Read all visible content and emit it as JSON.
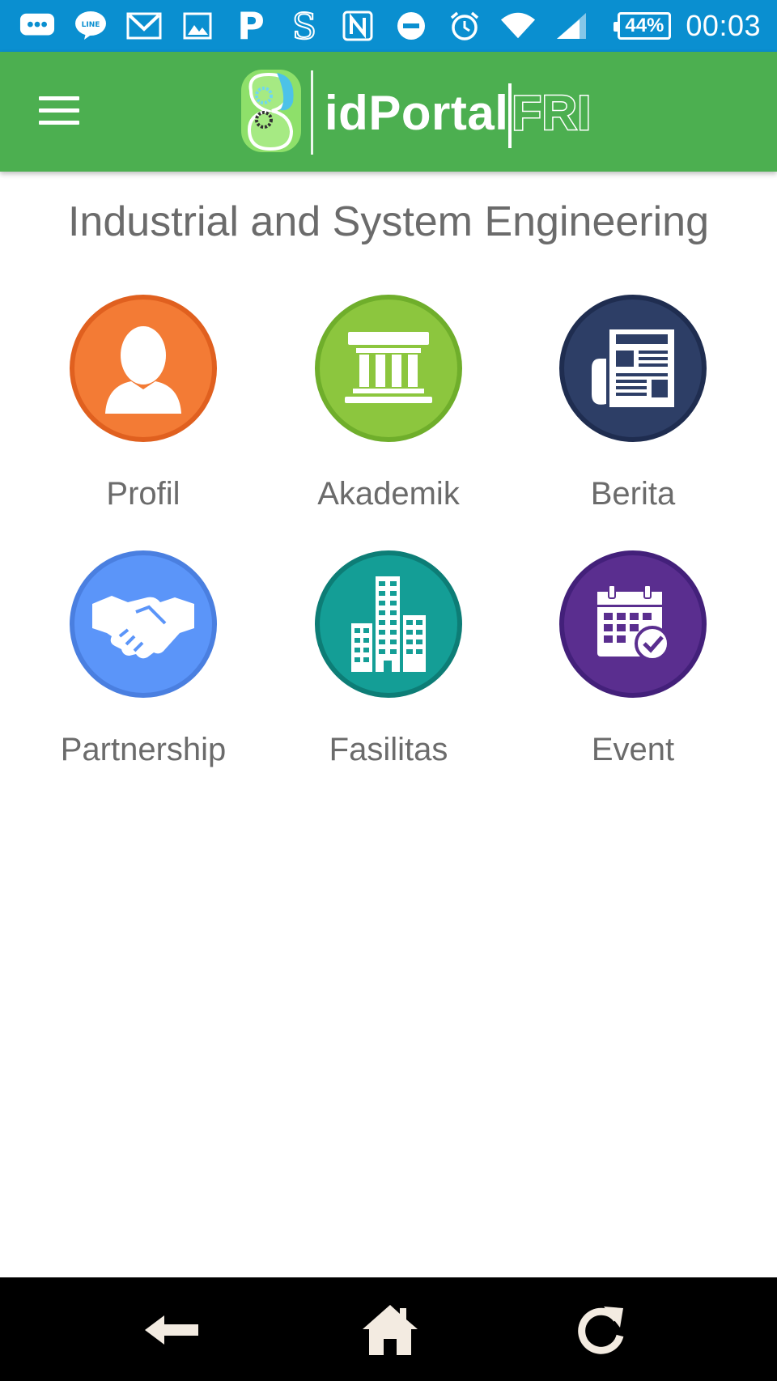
{
  "status_bar": {
    "battery": "44%",
    "time": "00:03",
    "icons": [
      "chat-icon",
      "line-icon",
      "gmail-icon",
      "gallery-icon",
      "pinterest-icon",
      "s-app-icon",
      "nfc-icon",
      "do-not-disturb-icon",
      "alarm-icon",
      "wifi-icon",
      "signal-icon",
      "battery-icon"
    ]
  },
  "app_bar": {
    "brand_main": "idPortal",
    "brand_accent": "FRI",
    "menu_icon": "hamburger-icon",
    "logo_icon": "fri-logo-icon"
  },
  "page": {
    "title": "Industrial and System Engineering"
  },
  "menu": [
    {
      "label": "Profil",
      "icon": "person-icon",
      "color": "#f37b35",
      "border": "#e0601f"
    },
    {
      "label": "Akademik",
      "icon": "institution-icon",
      "color": "#8cc63e",
      "border": "#6fae2b"
    },
    {
      "label": "Berita",
      "icon": "newspaper-icon",
      "color": "#2d3e66",
      "border": "#1f2d50"
    },
    {
      "label": "Partnership",
      "icon": "handshake-icon",
      "color": "#5b95f9",
      "border": "#4a7fe0"
    },
    {
      "label": "Fasilitas",
      "icon": "buildings-icon",
      "color": "#149e96",
      "border": "#0d7d76"
    },
    {
      "label": "Event",
      "icon": "calendar-icon",
      "color": "#5a2e8f",
      "border": "#43207a"
    }
  ],
  "nav_bar": {
    "back_icon": "back-arrow-icon",
    "home_icon": "home-icon",
    "reload_icon": "reload-icon"
  },
  "colors": {
    "status_bar": "#0a8fd0",
    "app_bar": "#4caf50",
    "text_gray": "#6b6b6b"
  }
}
